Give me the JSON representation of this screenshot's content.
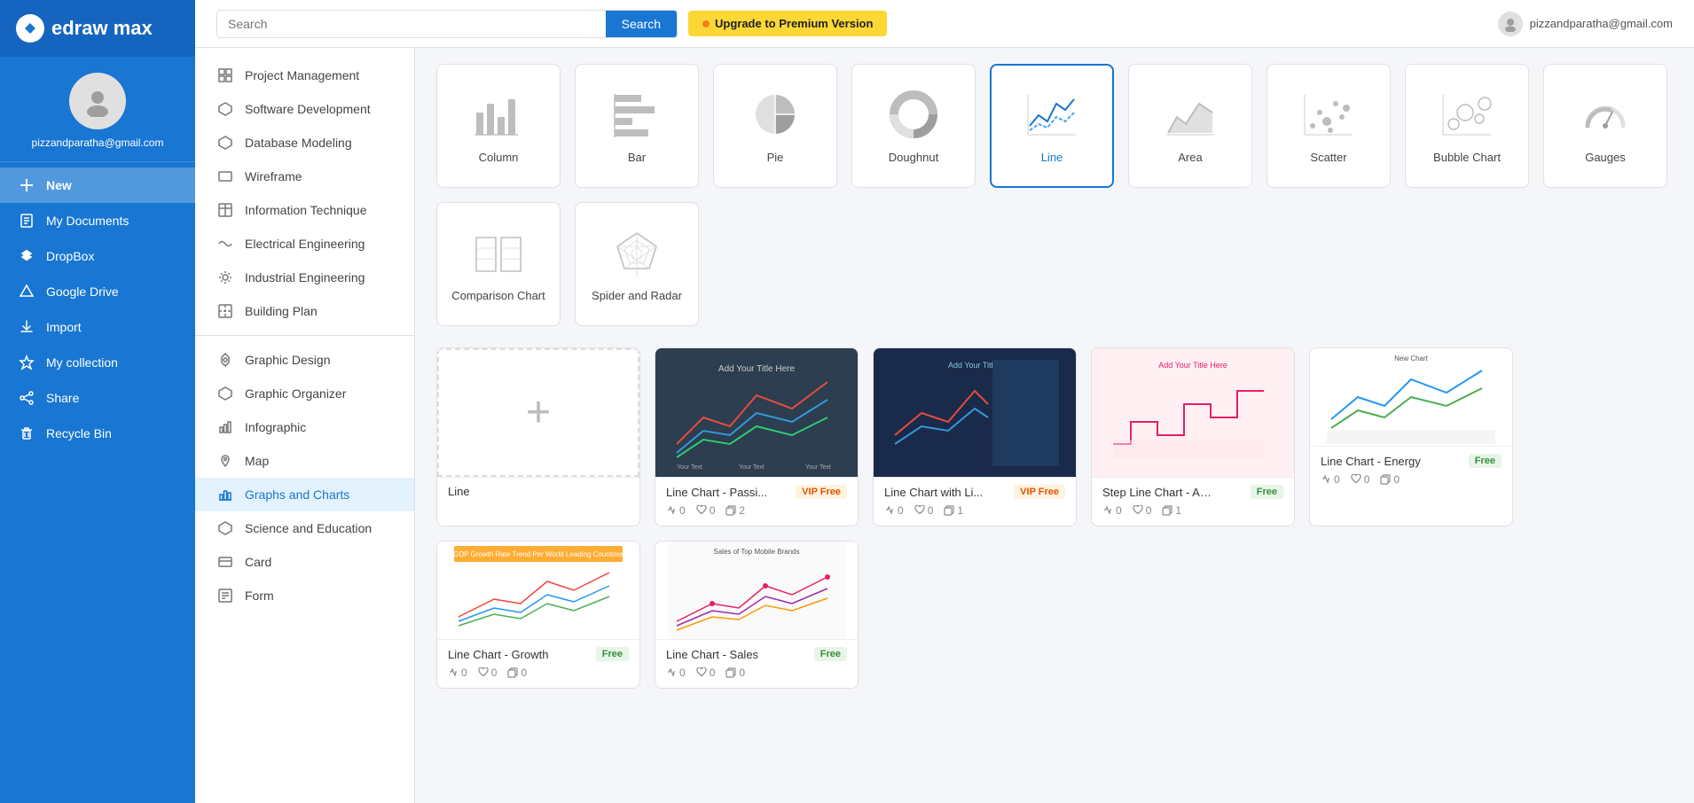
{
  "app": {
    "name": "edraw max",
    "logo_letter": "D"
  },
  "user": {
    "email": "pizzandparatha@gmail.com"
  },
  "header": {
    "search_placeholder": "Search",
    "search_button": "Search",
    "upgrade_button": "Upgrade to Premium Version",
    "user_email": "pizzandparatha@gmail.com"
  },
  "sidebar_nav": [
    {
      "id": "new",
      "label": "New",
      "icon": "➕"
    },
    {
      "id": "my-documents",
      "label": "My Documents",
      "icon": "📄"
    },
    {
      "id": "dropbox",
      "label": "DropBox",
      "icon": "📦"
    },
    {
      "id": "google-drive",
      "label": "Google Drive",
      "icon": "△"
    },
    {
      "id": "import",
      "label": "Import",
      "icon": "⬆"
    },
    {
      "id": "my-collection",
      "label": "My collection",
      "icon": "⭐"
    },
    {
      "id": "share",
      "label": "Share",
      "icon": "↗"
    },
    {
      "id": "recycle-bin",
      "label": "Recycle Bin",
      "icon": "🗑"
    }
  ],
  "categories": [
    {
      "id": "project-management",
      "label": "Project Management",
      "icon": "▦"
    },
    {
      "id": "software-development",
      "label": "Software Development",
      "icon": "⬡"
    },
    {
      "id": "database-modeling",
      "label": "Database Modeling",
      "icon": "⬡"
    },
    {
      "id": "wireframe",
      "label": "Wireframe",
      "icon": "▭"
    },
    {
      "id": "information-technique",
      "label": "Information Technique",
      "icon": "⊞"
    },
    {
      "id": "electrical-engineering",
      "label": "Electrical Engineering",
      "icon": "∿"
    },
    {
      "id": "industrial-engineering",
      "label": "Industrial Engineering",
      "icon": "⚙"
    },
    {
      "id": "building-plan",
      "label": "Building Plan",
      "icon": "⊞"
    },
    {
      "id": "graphic-design",
      "label": "Graphic Design",
      "icon": "◈"
    },
    {
      "id": "graphic-organizer",
      "label": "Graphic Organizer",
      "icon": "⬡"
    },
    {
      "id": "infographic",
      "label": "Infographic",
      "icon": "📊"
    },
    {
      "id": "map",
      "label": "Map",
      "icon": "📍"
    },
    {
      "id": "graphs-and-charts",
      "label": "Graphs and Charts",
      "icon": "📊",
      "active": true
    },
    {
      "id": "science-and-education",
      "label": "Science and Education",
      "icon": "⬡"
    },
    {
      "id": "card",
      "label": "Card",
      "icon": "▭"
    },
    {
      "id": "form",
      "label": "Form",
      "icon": "⊞"
    }
  ],
  "chart_types": [
    {
      "id": "column",
      "label": "Column"
    },
    {
      "id": "bar",
      "label": "Bar"
    },
    {
      "id": "pie",
      "label": "Pie"
    },
    {
      "id": "doughnut",
      "label": "Doughnut"
    },
    {
      "id": "line",
      "label": "Line",
      "selected": true
    },
    {
      "id": "area",
      "label": "Area"
    },
    {
      "id": "scatter",
      "label": "Scatter"
    },
    {
      "id": "bubble",
      "label": "Bubble Chart"
    },
    {
      "id": "gauges",
      "label": "Gauges"
    },
    {
      "id": "comparison",
      "label": "Comparison Chart"
    },
    {
      "id": "spider",
      "label": "Spider and Radar"
    }
  ],
  "templates": [
    {
      "id": "create-new",
      "label": "Line",
      "type": "create",
      "badge": ""
    },
    {
      "id": "line-passi",
      "label": "Line Chart - Passi...",
      "badge": "VIP Free",
      "badge_type": "vip",
      "stats": {
        "likes": 0,
        "hearts": 0,
        "copies": 2
      },
      "thumb_type": "dark"
    },
    {
      "id": "line-with-li",
      "label": "Line Chart with Li...",
      "badge": "VIP Free",
      "badge_type": "vip",
      "stats": {
        "likes": 0,
        "hearts": 0,
        "copies": 1
      },
      "thumb_type": "navy"
    },
    {
      "id": "step-line",
      "label": "Step Line Chart - Aut...",
      "badge": "Free",
      "badge_type": "free",
      "stats": {
        "likes": 0,
        "hearts": 0,
        "copies": 1
      },
      "thumb_type": "pink"
    },
    {
      "id": "line-energy",
      "label": "Line Chart - Energy",
      "badge": "Free",
      "badge_type": "free",
      "stats": {
        "likes": 0,
        "hearts": 0,
        "copies": 0
      },
      "thumb_type": "white"
    },
    {
      "id": "line-growth",
      "label": "Line Chart - Growth",
      "badge": "Free",
      "badge_type": "free",
      "stats": {
        "likes": 0,
        "hearts": 0,
        "copies": 0
      },
      "thumb_type": "white"
    },
    {
      "id": "line-sales",
      "label": "Line Chart - Sales",
      "badge": "Free",
      "badge_type": "free",
      "stats": {
        "likes": 0,
        "hearts": 0,
        "copies": 0
      },
      "thumb_type": "white"
    }
  ]
}
